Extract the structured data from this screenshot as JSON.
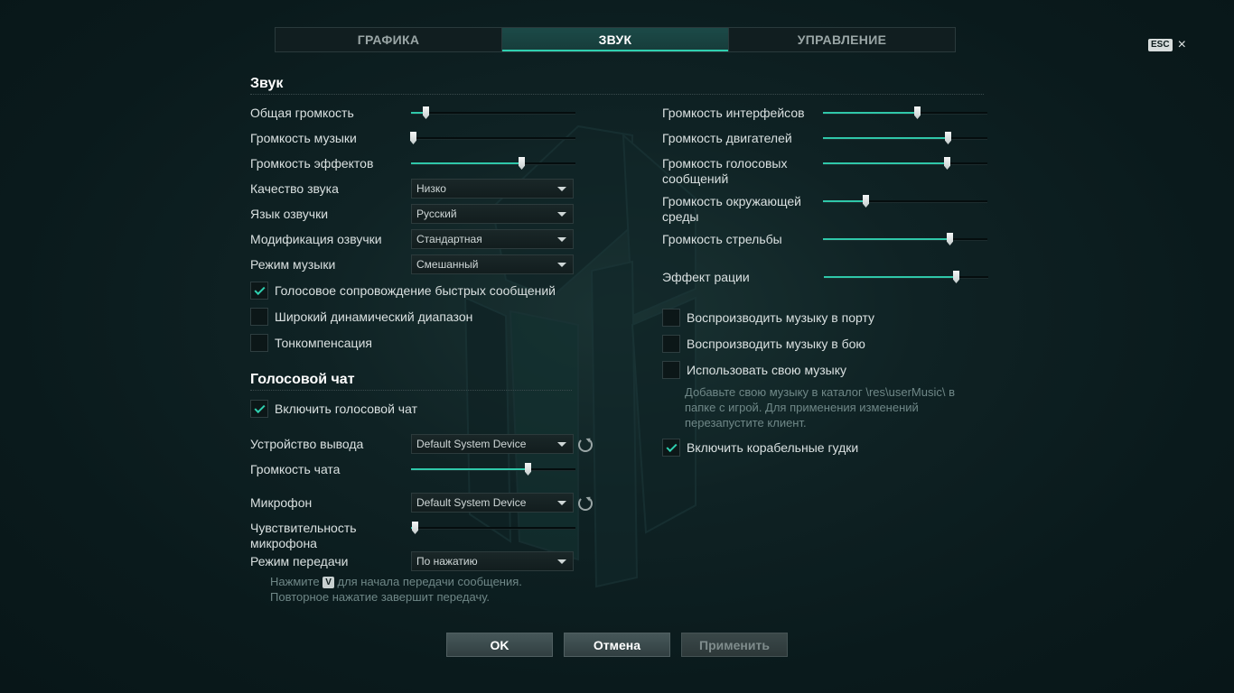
{
  "tabs": [
    {
      "label": "ГРАФИКА",
      "active": false
    },
    {
      "label": "ЗВУК",
      "active": true
    },
    {
      "label": "УПРАВЛЕНИЕ",
      "active": false
    }
  ],
  "esc": {
    "key": "ESC",
    "close": "×"
  },
  "sound": {
    "title": "Звук",
    "left_sliders": [
      {
        "label": "Общая громкость",
        "value": 0.09
      },
      {
        "label": "Громкость музыки",
        "value": 0.01
      },
      {
        "label": "Громкость эффектов",
        "value": 0.67
      }
    ],
    "dropdowns": [
      {
        "label": "Качество звука",
        "value": "Низко"
      },
      {
        "label": "Язык озвучки",
        "value": "Русский"
      },
      {
        "label": "Модификация озвучки",
        "value": "Стандартная"
      },
      {
        "label": "Режим музыки",
        "value": "Смешанный"
      }
    ],
    "left_checks": [
      {
        "label": "Голосовое сопровождение быстрых сообщений",
        "checked": true
      },
      {
        "label": "Широкий динамический диапазон",
        "checked": false
      },
      {
        "label": "Тонкомпенсация",
        "checked": false
      }
    ],
    "right_sliders": [
      {
        "label": "Громкость интерфейсов",
        "value": 0.57
      },
      {
        "label": "Громкость двигателей",
        "value": 0.76
      },
      {
        "label": "Громкость голосовых сообщений",
        "value": 0.75
      },
      {
        "label": "Громкость окружающей среды",
        "value": 0.26
      },
      {
        "label": "Громкость стрельбы",
        "value": 0.77
      },
      {
        "label": "Эффект рации",
        "value": 0.8
      }
    ],
    "right_checks": [
      {
        "label": "Воспроизводить музыку в порту",
        "checked": false
      },
      {
        "label": "Воспроизводить музыку в бою",
        "checked": false
      },
      {
        "label": "Использовать свою музыку",
        "checked": false
      }
    ],
    "music_hint": "Добавьте свою музыку в каталог \\res\\userMusic\\ в папке с игрой. Для применения изменений перезапустите клиент.",
    "horn_check": {
      "label": "Включить корабельные гудки",
      "checked": true
    }
  },
  "voice": {
    "title": "Голосовой чат",
    "enable_check": {
      "label": "Включить голосовой чат",
      "checked": true
    },
    "output_label": "Устройство вывода",
    "output_value": "Default System Device",
    "chat_volume_label": "Громкость чата",
    "chat_volume": 0.71,
    "mic_label": "Микрофон",
    "mic_value": "Default System Device",
    "sensitivity_label": "Чувствительность микрофона",
    "sensitivity": 0.02,
    "mode_label": "Режим передачи",
    "mode_value": "По нажатию",
    "hint_pre": "Нажмите",
    "hint_key": "V",
    "hint_post": "для начала передачи сообщения.",
    "hint_line2": "Повторное нажатие завершит передачу."
  },
  "buttons": {
    "ok": "OK",
    "cancel": "Отмена",
    "apply": "Применить"
  }
}
